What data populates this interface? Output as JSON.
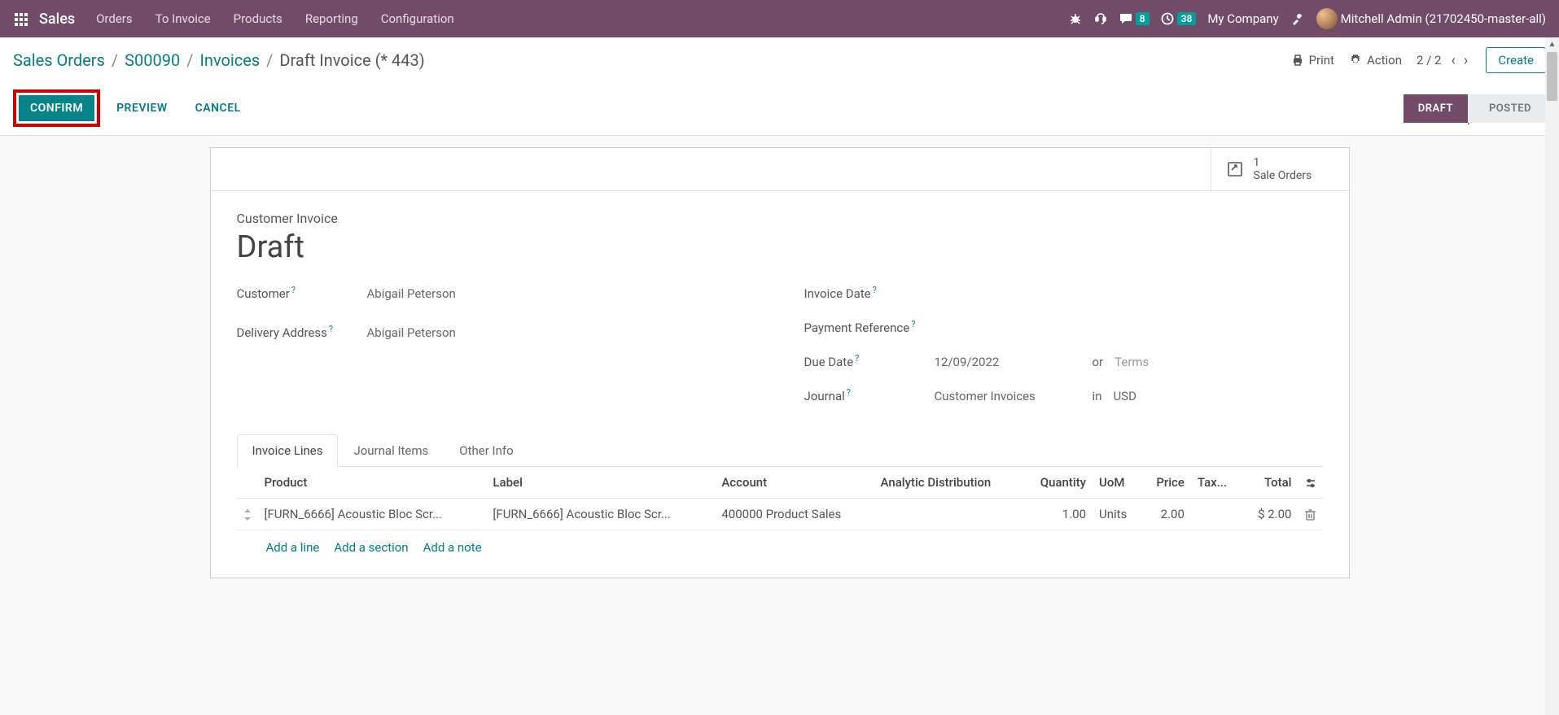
{
  "topbar": {
    "brand": "Sales",
    "menu": [
      "Orders",
      "To Invoice",
      "Products",
      "Reporting",
      "Configuration"
    ],
    "messages_badge": "8",
    "activities_badge": "38",
    "company": "My Company",
    "user": "Mitchell Admin (21702450-master-all)"
  },
  "breadcrumb": {
    "items": [
      "Sales Orders",
      "S00090",
      "Invoices"
    ],
    "current": "Draft Invoice (* 443)"
  },
  "controls": {
    "print": "Print",
    "action": "Action",
    "pager": "2 / 2",
    "create": "Create"
  },
  "actions": {
    "confirm": "CONFIRM",
    "preview": "PREVIEW",
    "cancel": "CANCEL"
  },
  "status": {
    "draft": "DRAFT",
    "posted": "POSTED"
  },
  "stat_button": {
    "count": "1",
    "label": "Sale Orders"
  },
  "form": {
    "title_label": "Customer Invoice",
    "title_value": "Draft",
    "customer_label": "Customer",
    "customer_value": "Abigail Peterson",
    "delivery_label": "Delivery Address",
    "delivery_value": "Abigail Peterson",
    "invoice_date_label": "Invoice Date",
    "invoice_date_value": "",
    "payment_ref_label": "Payment Reference",
    "payment_ref_value": "",
    "due_date_label": "Due Date",
    "due_date_value": "12/09/2022",
    "due_date_or": "or",
    "terms_placeholder": "Terms",
    "journal_label": "Journal",
    "journal_value": "Customer Invoices",
    "journal_in": "in",
    "currency": "USD"
  },
  "tabs": [
    "Invoice Lines",
    "Journal Items",
    "Other Info"
  ],
  "table": {
    "headers": {
      "product": "Product",
      "label": "Label",
      "account": "Account",
      "analytic": "Analytic Distribution",
      "quantity": "Quantity",
      "uom": "UoM",
      "price": "Price",
      "taxes": "Tax...",
      "total": "Total"
    },
    "rows": [
      {
        "product": "[FURN_6666] Acoustic Bloc Scr...",
        "label": "[FURN_6666] Acoustic Bloc Scr...",
        "account": "400000 Product Sales",
        "analytic": "",
        "quantity": "1.00",
        "uom": "Units",
        "price": "2.00",
        "taxes": "",
        "total": "$ 2.00"
      }
    ],
    "add_line": "Add a line",
    "add_section": "Add a section",
    "add_note": "Add a note"
  }
}
